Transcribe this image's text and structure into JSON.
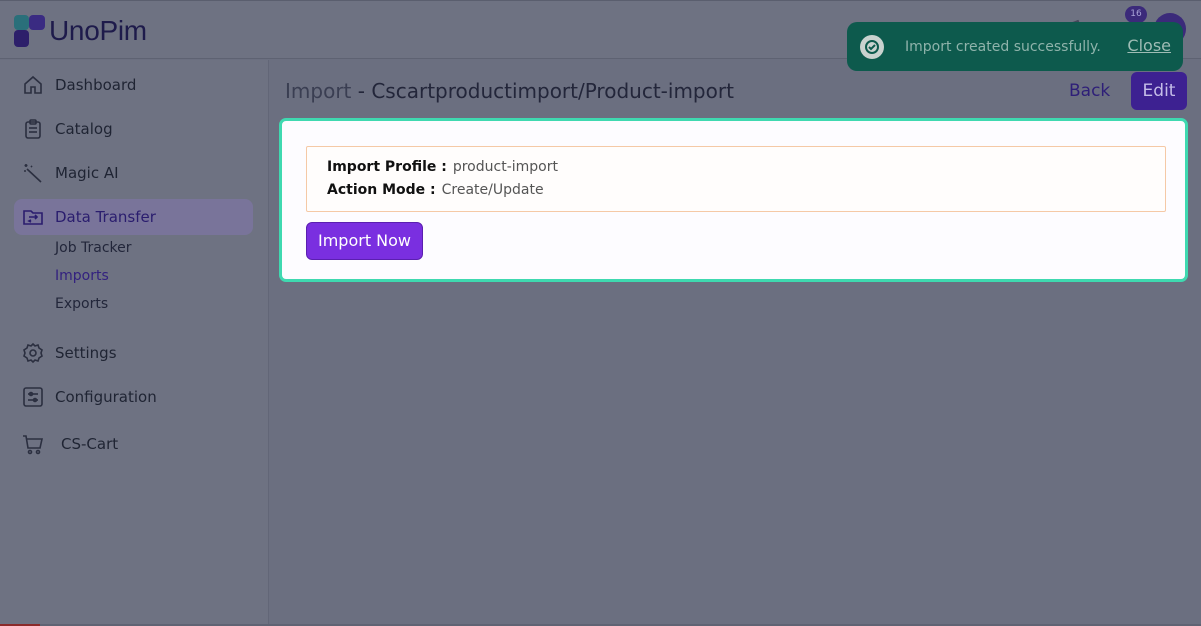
{
  "app": {
    "logo_text": "UnoPim",
    "notification_count": "16"
  },
  "sidebar": {
    "items": [
      {
        "label": "Dashboard",
        "icon": "home-icon"
      },
      {
        "label": "Catalog",
        "icon": "clipboard-icon"
      },
      {
        "label": "Magic AI",
        "icon": "magic-wand-icon"
      },
      {
        "label": "Data Transfer",
        "icon": "folder-transfer-icon",
        "active": true
      },
      {
        "label": "Settings",
        "icon": "gear-icon"
      },
      {
        "label": "Configuration",
        "icon": "sliders-icon"
      },
      {
        "label": "CS-Cart",
        "icon": "cart-icon"
      }
    ],
    "sub_items": [
      {
        "label": "Job Tracker"
      },
      {
        "label": "Imports",
        "active": true
      },
      {
        "label": "Exports"
      }
    ]
  },
  "page": {
    "title_prefix": "Import",
    "title_separator": " - ",
    "title_main": "Cscartproductimport/Product-import",
    "back_label": "Back",
    "edit_label": "Edit"
  },
  "import_info": {
    "profile_label": "Import Profile :",
    "profile_value": "product-import",
    "mode_label": "Action Mode :",
    "mode_value": "Create/Update",
    "import_now_label": "Import Now"
  },
  "toast": {
    "message": "Import created successfully.",
    "close_label": "Close"
  },
  "colors": {
    "primary": "#7a2fe0",
    "toast_bg": "#0d5a4d",
    "card_border": "#3fd9b0"
  }
}
